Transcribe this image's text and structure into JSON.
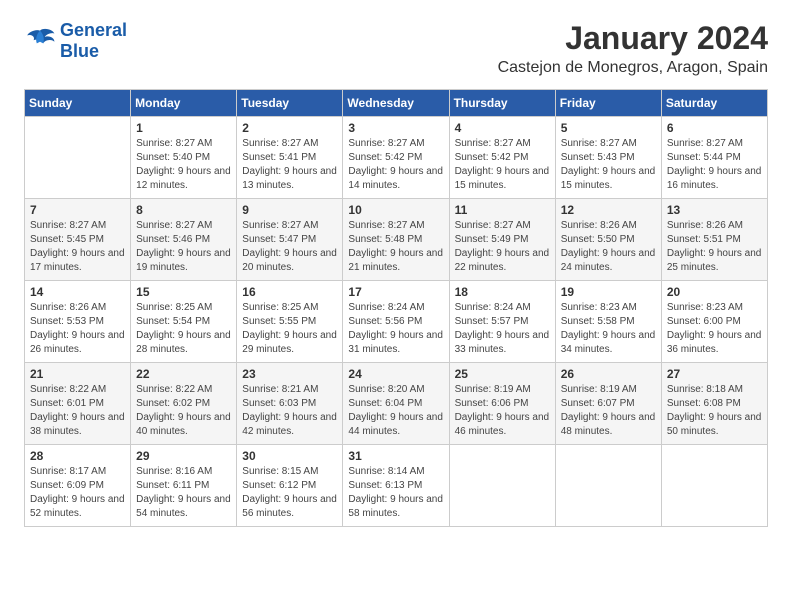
{
  "logo": {
    "line1": "General",
    "line2": "Blue"
  },
  "title": "January 2024",
  "location": "Castejon de Monegros, Aragon, Spain",
  "days_of_week": [
    "Sunday",
    "Monday",
    "Tuesday",
    "Wednesday",
    "Thursday",
    "Friday",
    "Saturday"
  ],
  "weeks": [
    [
      {
        "day": "",
        "sunrise": "",
        "sunset": "",
        "daylight": ""
      },
      {
        "day": "1",
        "sunrise": "Sunrise: 8:27 AM",
        "sunset": "Sunset: 5:40 PM",
        "daylight": "Daylight: 9 hours and 12 minutes."
      },
      {
        "day": "2",
        "sunrise": "Sunrise: 8:27 AM",
        "sunset": "Sunset: 5:41 PM",
        "daylight": "Daylight: 9 hours and 13 minutes."
      },
      {
        "day": "3",
        "sunrise": "Sunrise: 8:27 AM",
        "sunset": "Sunset: 5:42 PM",
        "daylight": "Daylight: 9 hours and 14 minutes."
      },
      {
        "day": "4",
        "sunrise": "Sunrise: 8:27 AM",
        "sunset": "Sunset: 5:42 PM",
        "daylight": "Daylight: 9 hours and 15 minutes."
      },
      {
        "day": "5",
        "sunrise": "Sunrise: 8:27 AM",
        "sunset": "Sunset: 5:43 PM",
        "daylight": "Daylight: 9 hours and 15 minutes."
      },
      {
        "day": "6",
        "sunrise": "Sunrise: 8:27 AM",
        "sunset": "Sunset: 5:44 PM",
        "daylight": "Daylight: 9 hours and 16 minutes."
      }
    ],
    [
      {
        "day": "7",
        "sunrise": "Sunrise: 8:27 AM",
        "sunset": "Sunset: 5:45 PM",
        "daylight": "Daylight: 9 hours and 17 minutes."
      },
      {
        "day": "8",
        "sunrise": "Sunrise: 8:27 AM",
        "sunset": "Sunset: 5:46 PM",
        "daylight": "Daylight: 9 hours and 19 minutes."
      },
      {
        "day": "9",
        "sunrise": "Sunrise: 8:27 AM",
        "sunset": "Sunset: 5:47 PM",
        "daylight": "Daylight: 9 hours and 20 minutes."
      },
      {
        "day": "10",
        "sunrise": "Sunrise: 8:27 AM",
        "sunset": "Sunset: 5:48 PM",
        "daylight": "Daylight: 9 hours and 21 minutes."
      },
      {
        "day": "11",
        "sunrise": "Sunrise: 8:27 AM",
        "sunset": "Sunset: 5:49 PM",
        "daylight": "Daylight: 9 hours and 22 minutes."
      },
      {
        "day": "12",
        "sunrise": "Sunrise: 8:26 AM",
        "sunset": "Sunset: 5:50 PM",
        "daylight": "Daylight: 9 hours and 24 minutes."
      },
      {
        "day": "13",
        "sunrise": "Sunrise: 8:26 AM",
        "sunset": "Sunset: 5:51 PM",
        "daylight": "Daylight: 9 hours and 25 minutes."
      }
    ],
    [
      {
        "day": "14",
        "sunrise": "Sunrise: 8:26 AM",
        "sunset": "Sunset: 5:53 PM",
        "daylight": "Daylight: 9 hours and 26 minutes."
      },
      {
        "day": "15",
        "sunrise": "Sunrise: 8:25 AM",
        "sunset": "Sunset: 5:54 PM",
        "daylight": "Daylight: 9 hours and 28 minutes."
      },
      {
        "day": "16",
        "sunrise": "Sunrise: 8:25 AM",
        "sunset": "Sunset: 5:55 PM",
        "daylight": "Daylight: 9 hours and 29 minutes."
      },
      {
        "day": "17",
        "sunrise": "Sunrise: 8:24 AM",
        "sunset": "Sunset: 5:56 PM",
        "daylight": "Daylight: 9 hours and 31 minutes."
      },
      {
        "day": "18",
        "sunrise": "Sunrise: 8:24 AM",
        "sunset": "Sunset: 5:57 PM",
        "daylight": "Daylight: 9 hours and 33 minutes."
      },
      {
        "day": "19",
        "sunrise": "Sunrise: 8:23 AM",
        "sunset": "Sunset: 5:58 PM",
        "daylight": "Daylight: 9 hours and 34 minutes."
      },
      {
        "day": "20",
        "sunrise": "Sunrise: 8:23 AM",
        "sunset": "Sunset: 6:00 PM",
        "daylight": "Daylight: 9 hours and 36 minutes."
      }
    ],
    [
      {
        "day": "21",
        "sunrise": "Sunrise: 8:22 AM",
        "sunset": "Sunset: 6:01 PM",
        "daylight": "Daylight: 9 hours and 38 minutes."
      },
      {
        "day": "22",
        "sunrise": "Sunrise: 8:22 AM",
        "sunset": "Sunset: 6:02 PM",
        "daylight": "Daylight: 9 hours and 40 minutes."
      },
      {
        "day": "23",
        "sunrise": "Sunrise: 8:21 AM",
        "sunset": "Sunset: 6:03 PM",
        "daylight": "Daylight: 9 hours and 42 minutes."
      },
      {
        "day": "24",
        "sunrise": "Sunrise: 8:20 AM",
        "sunset": "Sunset: 6:04 PM",
        "daylight": "Daylight: 9 hours and 44 minutes."
      },
      {
        "day": "25",
        "sunrise": "Sunrise: 8:19 AM",
        "sunset": "Sunset: 6:06 PM",
        "daylight": "Daylight: 9 hours and 46 minutes."
      },
      {
        "day": "26",
        "sunrise": "Sunrise: 8:19 AM",
        "sunset": "Sunset: 6:07 PM",
        "daylight": "Daylight: 9 hours and 48 minutes."
      },
      {
        "day": "27",
        "sunrise": "Sunrise: 8:18 AM",
        "sunset": "Sunset: 6:08 PM",
        "daylight": "Daylight: 9 hours and 50 minutes."
      }
    ],
    [
      {
        "day": "28",
        "sunrise": "Sunrise: 8:17 AM",
        "sunset": "Sunset: 6:09 PM",
        "daylight": "Daylight: 9 hours and 52 minutes."
      },
      {
        "day": "29",
        "sunrise": "Sunrise: 8:16 AM",
        "sunset": "Sunset: 6:11 PM",
        "daylight": "Daylight: 9 hours and 54 minutes."
      },
      {
        "day": "30",
        "sunrise": "Sunrise: 8:15 AM",
        "sunset": "Sunset: 6:12 PM",
        "daylight": "Daylight: 9 hours and 56 minutes."
      },
      {
        "day": "31",
        "sunrise": "Sunrise: 8:14 AM",
        "sunset": "Sunset: 6:13 PM",
        "daylight": "Daylight: 9 hours and 58 minutes."
      },
      {
        "day": "",
        "sunrise": "",
        "sunset": "",
        "daylight": ""
      },
      {
        "day": "",
        "sunrise": "",
        "sunset": "",
        "daylight": ""
      },
      {
        "day": "",
        "sunrise": "",
        "sunset": "",
        "daylight": ""
      }
    ]
  ]
}
